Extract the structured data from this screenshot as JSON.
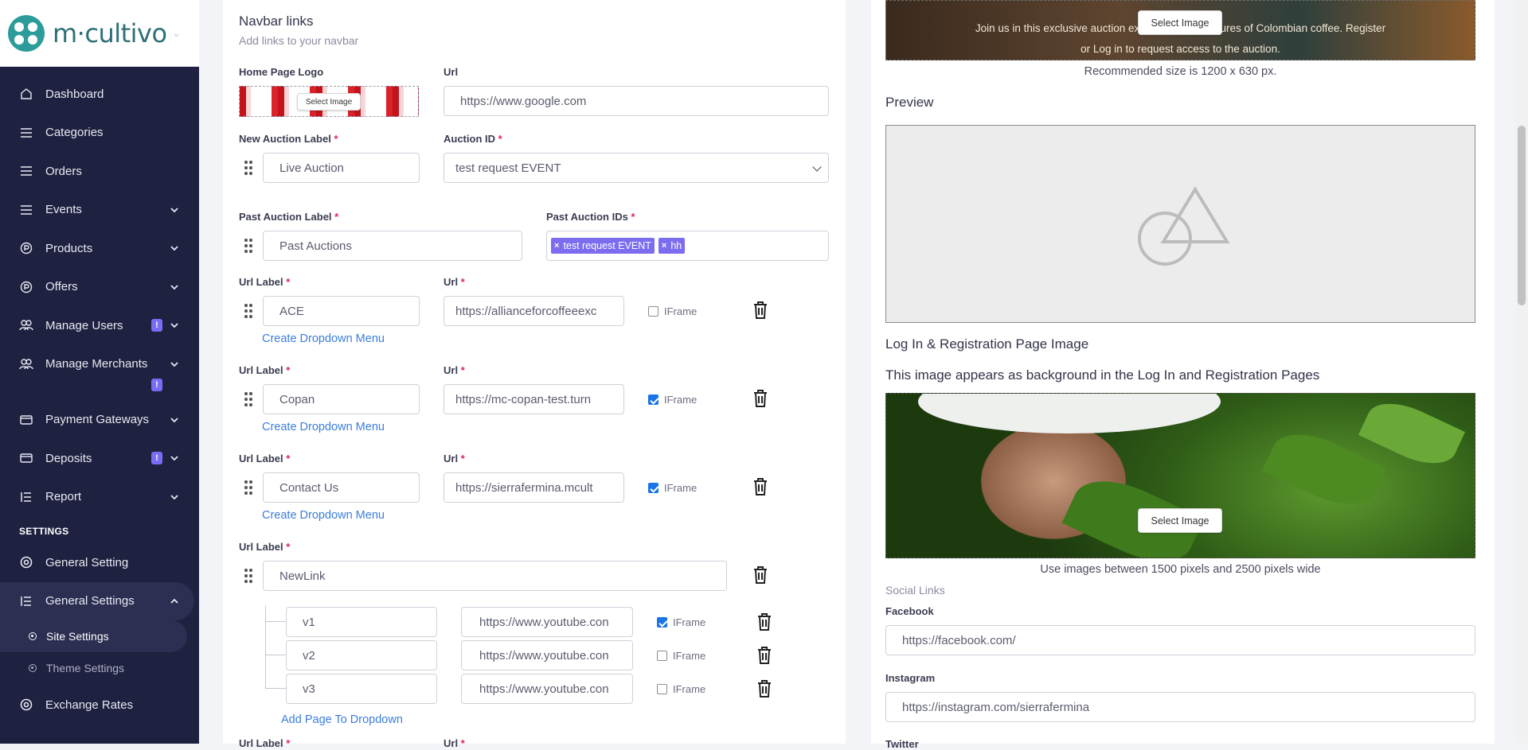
{
  "brand": {
    "name": "m·cultivo"
  },
  "sidebar": {
    "items": [
      {
        "label": "Dashboard",
        "icon": "home-icon"
      },
      {
        "label": "Categories",
        "icon": "list-icon"
      },
      {
        "label": "Orders",
        "icon": "list-icon"
      },
      {
        "label": "Events",
        "icon": "list-icon"
      },
      {
        "label": "Products",
        "icon": "product-icon"
      },
      {
        "label": "Offers",
        "icon": "product-icon"
      },
      {
        "label": "Manage Users",
        "icon": "users-icon",
        "badge": "!"
      },
      {
        "label": "Manage Merchants",
        "icon": "merchants-icon",
        "badge": "!"
      },
      {
        "label": "Payment Gateways",
        "icon": "card-icon"
      },
      {
        "label": "Deposits",
        "icon": "card-icon",
        "badge": "!"
      },
      {
        "label": "Report",
        "icon": "report-icon"
      }
    ],
    "section_label": "SETTINGS",
    "settings_items": [
      {
        "label": "General Setting",
        "icon": "gear-circle-icon"
      },
      {
        "label": "General Settings",
        "icon": "settings-list-icon"
      }
    ],
    "sub_items": [
      {
        "label": "Site Settings"
      },
      {
        "label": "Theme Settings"
      }
    ],
    "last_item": {
      "label": "Exchange Rates",
      "icon": "gear-circle-icon"
    }
  },
  "navbar": {
    "title": "Navbar links",
    "subtitle": "Add links to your navbar",
    "home_logo_label": "Home Page Logo",
    "url_label": "Url",
    "logo_select_label": "Select Image",
    "home_url": "https://www.google.com",
    "new_auction_label": "New Auction Label",
    "new_auction_value": "Live Auction",
    "auction_id_label": "Auction ID",
    "auction_id_value": "test request EVENT",
    "past_auction_label": "Past Auction Label",
    "past_auction_value": "Past Auctions",
    "past_auction_ids_label": "Past Auction IDs",
    "past_auction_tags": [
      "test request EVENT",
      "hh"
    ],
    "required_mark": "*",
    "url_label_text": "Url Label",
    "url_text": "Url",
    "iframe_label": "IFrame",
    "create_dropdown": "Create Dropdown Menu",
    "links": [
      {
        "label": "ACE",
        "url": "https://allianceforcoffeeexc",
        "iframe": false
      },
      {
        "label": "Copan",
        "url": "https://mc-copan-test.turn",
        "iframe": true
      },
      {
        "label": "Contact Us",
        "url": "https://sierrafermina.mcult",
        "iframe": true
      }
    ],
    "dropdown_link": {
      "label": "NewLink"
    },
    "dropdown_items": [
      {
        "label": "v1",
        "url": "https://www.youtube.con",
        "iframe": true
      },
      {
        "label": "v2",
        "url": "https://www.youtube.con",
        "iframe": false
      },
      {
        "label": "v3",
        "url": "https://www.youtube.con",
        "iframe": false
      }
    ],
    "add_page": "Add Page To Dropdown"
  },
  "right": {
    "banner_text_line1": "Join us in this exclusive auction experienc          rue treasures of Colombian coffee. Register",
    "banner_text_line2": "or Log in to request access to the auction.",
    "banner_select": "Select Image",
    "recommended": "Recommended size is 1200 x 630 px.",
    "preview_title": "Preview",
    "login_title": "Log In & Registration Page Image",
    "login_desc": "This image appears as background in the Log In and Registration Pages",
    "login_select": "Select Image",
    "login_hint": "Use images between 1500 pixels and 2500 pixels wide",
    "social_title": "Social Links",
    "facebook_label": "Facebook",
    "facebook_url": "https://facebook.com/",
    "instagram_label": "Instagram",
    "instagram_url": "https://instagram.com/sierrafermina",
    "twitter_label": "Twitter"
  },
  "colors": {
    "sidebar": "#1f2140",
    "accent": "#7b6cf5",
    "link": "#3b7ddd",
    "required": "#e0245e"
  }
}
